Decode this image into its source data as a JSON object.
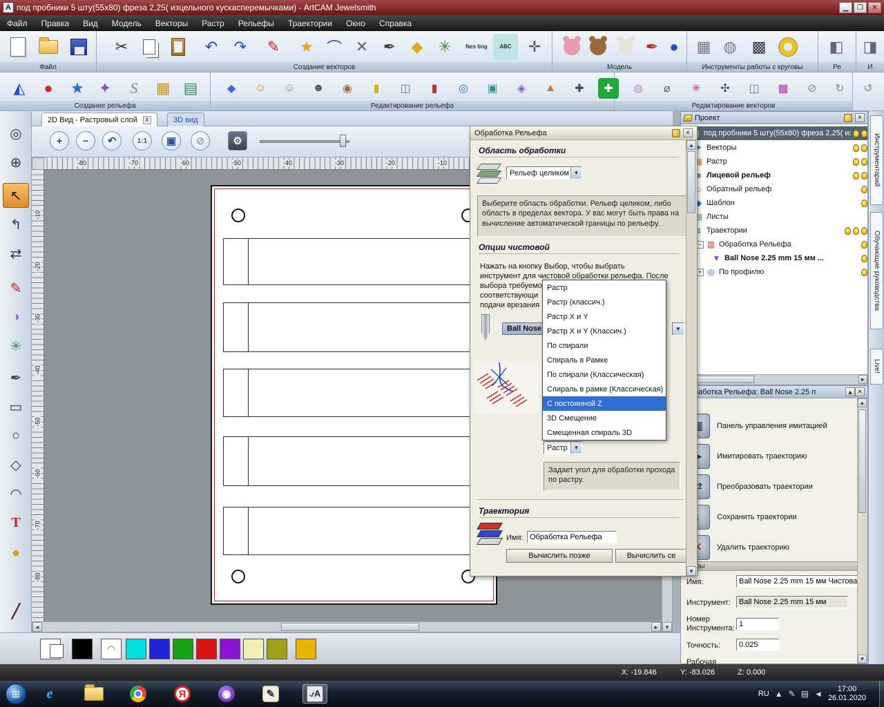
{
  "window": {
    "title": "под пробники 5 шту(55x80) фреза 2,25( изцельного кускасперемычками) - ArtCAM Jewelsmith"
  },
  "menu": {
    "items": [
      "Файл",
      "Правка",
      "Вид",
      "Модель",
      "Векторы",
      "Растр",
      "Рельефы",
      "Траектории",
      "Окно",
      "Справка"
    ]
  },
  "ribbon1": {
    "groups": [
      "Файл",
      "Создание векторов",
      "Модель",
      "Инструменты работы с круговы",
      "Ре",
      "И"
    ],
    "nesting_icon_text": "Nes ting",
    "abc_icon_text": "ABC"
  },
  "ribbon2": {
    "groups": [
      "Создание рельефа",
      "Редактирование рельефа",
      "Редактирование векторов"
    ]
  },
  "view_tabs": {
    "tab2d": "2D Вид - Растровый слой",
    "tab3d": "3D вид",
    "close": "x",
    "actual_size": "1:1"
  },
  "rulers": {
    "h": [
      "-80",
      "-70",
      "-60",
      "-50",
      "-40",
      "-30",
      "-20",
      "-10"
    ],
    "v": [
      "-10",
      "-20",
      "-30",
      "-40",
      "-50",
      "-60",
      "-70",
      "-80"
    ]
  },
  "machining_dialog": {
    "title": "Обработка Рельефа",
    "area_section": "Область обработки",
    "area_combo": "Рельеф целиком",
    "area_help": "Выберите область обработки. Рельеф целиком, либо область в пределах вектора. У вас могут быть права на вычисление автоматической границы по рельефу.",
    "finish_section": "Опции чистовой",
    "finish_help_lines": [
      "Нажать на кнопку Выбор, чтобы выбрать",
      "инструмент для чистовой обработки рельефа. После",
      "выбора требуемо",
      "соответствующи",
      "подачи врезания"
    ],
    "tool_button": "Ball Nose",
    "strategy_options": [
      "Растр",
      "Растр (классич.)",
      "Растр X и Y",
      "Растр X и Y (Классич.)",
      "По спирали",
      "Спираль в Рамке",
      "По спирали (Классическая)",
      "Спираль в рамке (Классическая)",
      "С постоянной Z",
      "3D Смещение",
      "Смещенная спираль 3D"
    ],
    "strategy_selected": "С постоянной Z",
    "angle_combo": "Растр",
    "angle_help": "Задает угол для обработки прохода по растру.",
    "toolpath_section": "Траектория",
    "name_label": "Имя:",
    "name_value": "Обработка Рельефа",
    "calc_later_button": "Вычислить позже",
    "calc_now_button": "Вычислить се"
  },
  "project_panel": {
    "title": "Проект",
    "root": "под пробники 5 шту(55x80) фреза 2,25( изц...",
    "items": [
      "Векторы",
      "Растр",
      "Лицевой рельеф",
      "Обратный рельеф",
      "Шаблон",
      "Листы",
      "Траектории",
      "Обработка Рельефа",
      "Ball Nose 2.25 mm 15 мм ...",
      "По профилю"
    ]
  },
  "toolpath_panel": {
    "title": "Обработка Рельефа: Ball Nose 2.25 п",
    "operations": [
      "Панель управления имитацией",
      "Имитировать траекторию",
      "Преобразовать траектории",
      "Сохранить траектории",
      "Удалить траекторию"
    ],
    "params_header": "метры",
    "fields": {
      "name_label": "Имя:",
      "name_value": "Ball Nose 2.25 mm 15 мм Чистова",
      "tool_label": "Инструмент:",
      "tool_value": "Ball Nose 2.25 mm 15 мм",
      "number_label_1": "Номер",
      "number_label_2": "Инструмента:",
      "number_value": "1",
      "tolerance_label": "Точность:",
      "tolerance_value": "0.025",
      "clipped_label": "Рабочая"
    }
  },
  "right_tabs": [
    "Инструментарий",
    "Обучающие руководства",
    "Live!"
  ],
  "status": {
    "x": "X: -19.846",
    "y": "Y: -83.026",
    "z": "Z: 0.000"
  },
  "taskbar": {
    "lang": "RU",
    "time": "17:00",
    "date": "26.01.2020"
  },
  "colors": {
    "titlebar": "#6e1616",
    "selection_blue": "#2f6fd0",
    "tree_selection": "#55626f",
    "active_tool_orange": "#e08a28",
    "palette_swatches": [
      "#ffffff",
      "#000000",
      "#00dede",
      "#2121d8",
      "#18a018",
      "#d81414",
      "#8c14d8",
      "#f0f0b4",
      "#a0a018",
      "#e8b400"
    ]
  }
}
